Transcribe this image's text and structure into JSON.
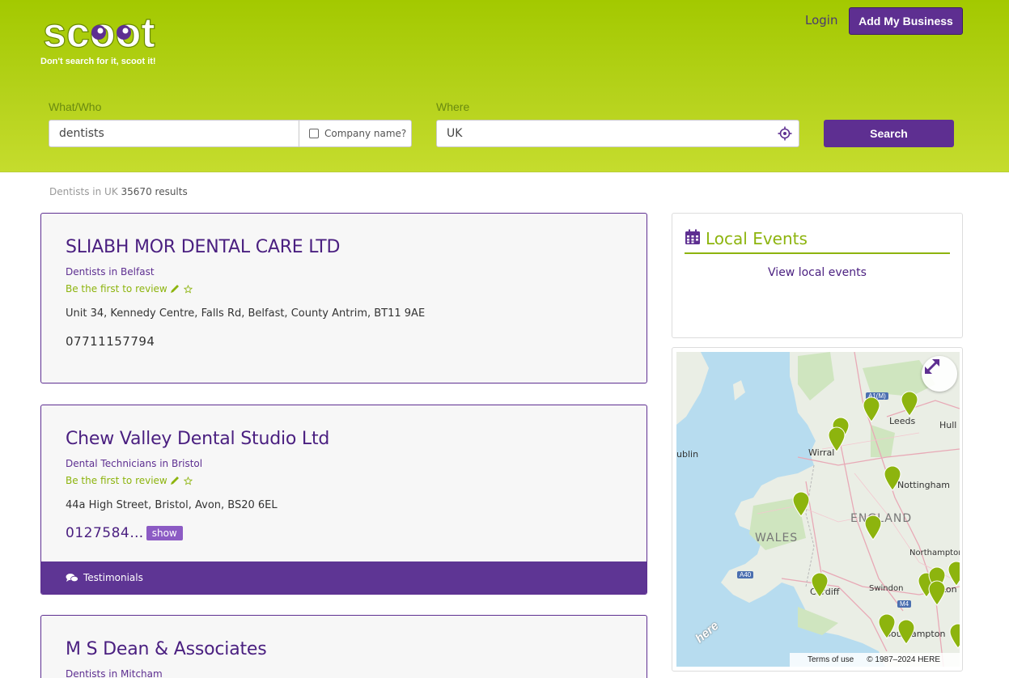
{
  "header": {
    "logo_text": "scoot",
    "tagline": "Don't search for it, scoot it!",
    "login_label": "Login",
    "add_business_label": "Add My Business"
  },
  "search": {
    "what_label": "What/Who",
    "what_value": "dentists",
    "company_name_label": "Company name?",
    "company_name_checked": false,
    "where_label": "Where",
    "where_value": "UK",
    "search_button": "Search"
  },
  "results": {
    "prefix": "Dentists in UK",
    "count": "35670 results"
  },
  "listings": [
    {
      "name": "SLIABH MOR DENTAL CARE LTD",
      "category": "Dentists in Belfast",
      "review": "Be the first to review",
      "address": "Unit 34, Kennedy Centre, Falls Rd, Belfast, County Antrim, BT11 9AE",
      "phone": "07711157794"
    },
    {
      "name": "Chew Valley Dental Studio Ltd",
      "category": "Dental Technicians in Bristol",
      "review": "Be the first to review",
      "address": "44a High Street, Bristol, Avon, BS20 6EL",
      "phone": "0127584…",
      "show_label": "show",
      "testimonials_label": "Testimonials"
    },
    {
      "name": "M S Dean & Associates",
      "category": "Dentists in Mitcham"
    }
  ],
  "sidebar": {
    "events_title": "Local Events",
    "events_link": "View local events"
  },
  "map": {
    "labels": {
      "leeds": "Leeds",
      "hull": "Hull",
      "dublin": "ublin",
      "wirral": "Wirral",
      "nottingham": "Nottingham",
      "england": "ENGLAND",
      "wales": "WALES",
      "northampton": "Northampton",
      "swindon": "Swindon",
      "cardiff": "Cardiff",
      "london": "Lon",
      "southampton": "Southampton"
    },
    "road_shields": [
      "A1(M)",
      "A40",
      "M4"
    ],
    "terms": "Terms of use",
    "copyright": "© 1987–2024 HERE",
    "provider": "here",
    "pin_color": "#8db40e"
  },
  "colors": {
    "brand_purple": "#5e2f91",
    "brand_green": "#a3c900"
  }
}
